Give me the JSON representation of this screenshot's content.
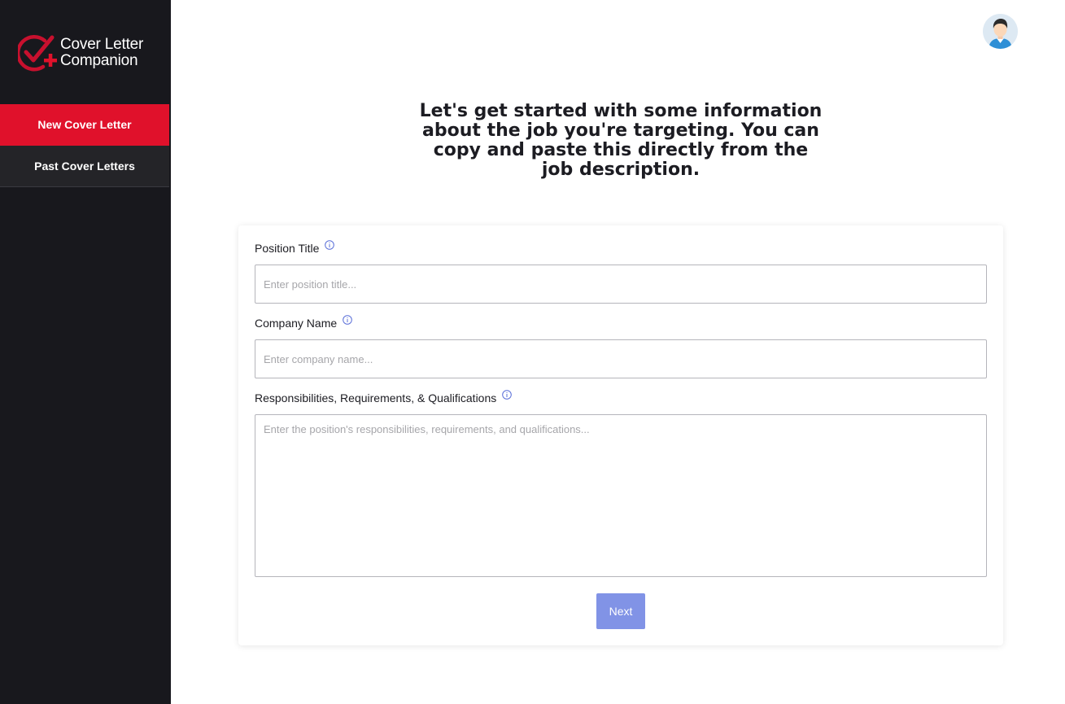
{
  "app": {
    "logo_line1": "Cover Letter",
    "logo_line2": "Companion",
    "brand_color": "#e0112b"
  },
  "sidebar": {
    "items": [
      {
        "label": "New Cover Letter",
        "active": true
      },
      {
        "label": "Past Cover Letters",
        "active": false
      }
    ]
  },
  "header": {
    "avatar_icon": "user-avatar-icon"
  },
  "main": {
    "heading": "Let's get started with some information about the job you're targeting. You can copy and paste this directly from the job description.",
    "form": {
      "position_title": {
        "label": "Position Title",
        "placeholder": "Enter position title...",
        "value": ""
      },
      "company_name": {
        "label": "Company Name",
        "placeholder": "Enter company name...",
        "value": ""
      },
      "responsibilities": {
        "label": "Responsibilities, Requirements, & Qualifications",
        "placeholder": "Enter the position's responsibilities, requirements, and qualifications...",
        "value": ""
      },
      "next_label": "Next"
    }
  }
}
